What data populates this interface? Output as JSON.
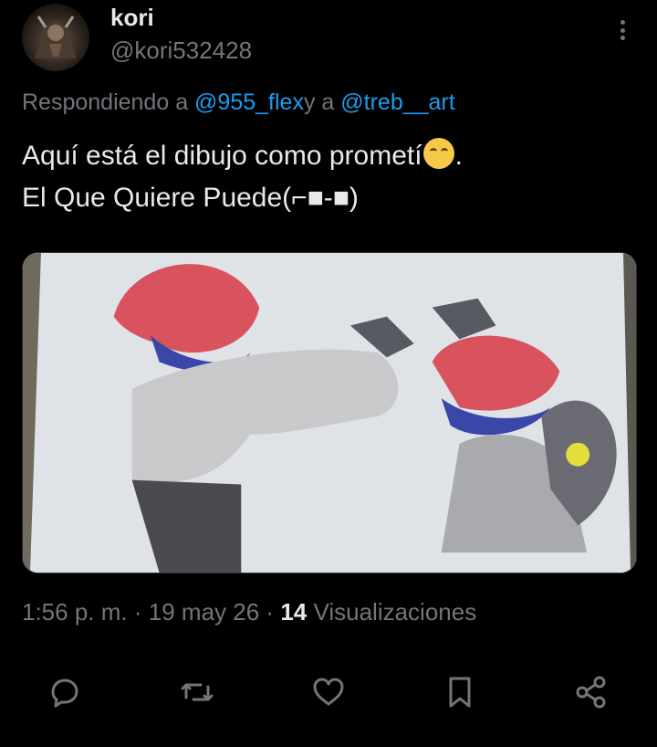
{
  "author": {
    "name": "kori",
    "handle": "@kori532428"
  },
  "reply": {
    "prefix": "Respondiendo a",
    "mention1": "@955_flex",
    "joiner": "y a",
    "mention2": "@treb__art"
  },
  "post": {
    "line1_before_emoji": "Aquí está el dibujo como prometí",
    "line1_after_emoji": ".",
    "line2": "El Que Quiere Puede(⌐■-■)",
    "emoji": "hugging-face-icon"
  },
  "media": {
    "description_icon": "drawing-image"
  },
  "meta": {
    "time": "1:56 p. m.",
    "sep1": "·",
    "date": "19 may 26",
    "sep2": "·",
    "views_count": "14",
    "views_label": "Visualizaciones"
  },
  "actions": [
    "reply-icon",
    "repost-icon",
    "like-icon",
    "bookmark-icon",
    "share-icon"
  ],
  "colors": {
    "background": "#000000",
    "text": "#e7e9ea",
    "muted": "#71767b",
    "link": "#1d9bf0"
  }
}
